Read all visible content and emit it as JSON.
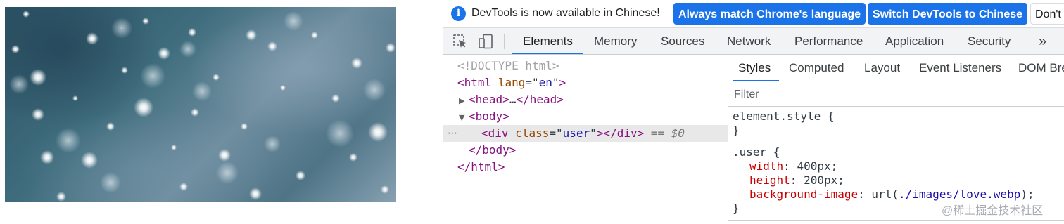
{
  "page_preview": {
    "background_image_description": "starry bokeh background"
  },
  "devtools": {
    "infobar": {
      "message": "DevTools is now available in Chinese!",
      "btn_match": "Always match Chrome's language",
      "btn_switch": "Switch DevTools to Chinese",
      "btn_dont": "Don't"
    },
    "tabs": [
      "Elements",
      "Memory",
      "Sources",
      "Network",
      "Performance",
      "Application",
      "Security"
    ],
    "more_tabs": "»",
    "dom": {
      "doctype": "<!DOCTYPE html>",
      "html_tag": "html",
      "lang_attr": "lang",
      "lang_val": "en",
      "head_tag": "head",
      "head_ellipsis": "…",
      "body_tag": "body",
      "div_tag": "div",
      "class_attr": "class",
      "class_val": "user",
      "selected_marker": "== $0",
      "row_dots": "⋯"
    },
    "side_tabs": [
      "Styles",
      "Computed",
      "Layout",
      "Event Listeners",
      "DOM Bre"
    ],
    "filter_placeholder": "Filter",
    "element_style": {
      "selector": "element.style {",
      "close": "}"
    },
    "user_rule": {
      "selector": ".user {",
      "width_prop": "width",
      "width_val": "400px;",
      "height_prop": "height",
      "height_val": "200px;",
      "bg_prop": "background-image",
      "bg_fn_open": "url(",
      "bg_url": "./images/love.webp",
      "bg_fn_close": ");",
      "close": "}"
    }
  },
  "watermark": "@稀土掘金技术社区",
  "colors": {
    "accent": "#1a73e8",
    "tag": "#881280",
    "attr": "#994500",
    "attr_value": "#1a1aa6",
    "css_prop": "#c80000"
  }
}
